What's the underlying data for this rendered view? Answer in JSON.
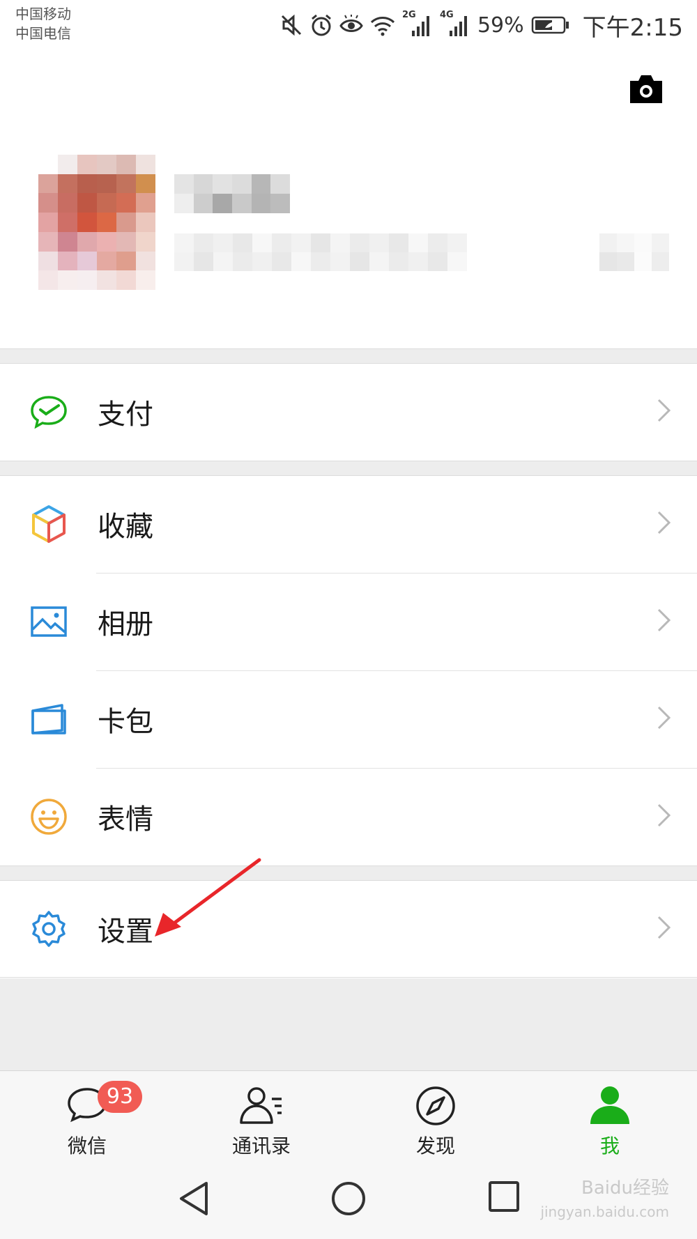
{
  "status_bar": {
    "carrier_1": "中国移动",
    "carrier_2": "中国电信",
    "network_1": "2G",
    "network_2": "4G",
    "battery": "59%",
    "time": "下午2:15"
  },
  "header": {
    "camera_icon": "camera-icon"
  },
  "menu": {
    "pay": {
      "label": "支付",
      "icon": "wechat-pay-icon",
      "color": "#1aad19"
    },
    "favorites": {
      "label": "收藏",
      "icon": "cube-icon"
    },
    "album": {
      "label": "相册",
      "icon": "picture-icon",
      "color": "#2a8ad8"
    },
    "cards": {
      "label": "卡包",
      "icon": "card-icon",
      "color": "#2a8ad8"
    },
    "stickers": {
      "label": "表情",
      "icon": "smile-icon",
      "color": "#f0a93b"
    },
    "settings": {
      "label": "设置",
      "icon": "gear-icon",
      "color": "#2a8ad8"
    }
  },
  "tabbar": {
    "chats": {
      "label": "微信",
      "badge": "93"
    },
    "contacts": {
      "label": "通讯录"
    },
    "discover": {
      "label": "发现"
    },
    "me": {
      "label": "我",
      "active": true,
      "active_color": "#1aad19"
    }
  },
  "watermark": {
    "line1": "Baidu经验",
    "line2": "jingyan.baidu.com"
  },
  "annotation": {
    "arrow_color": "#e8262a"
  }
}
